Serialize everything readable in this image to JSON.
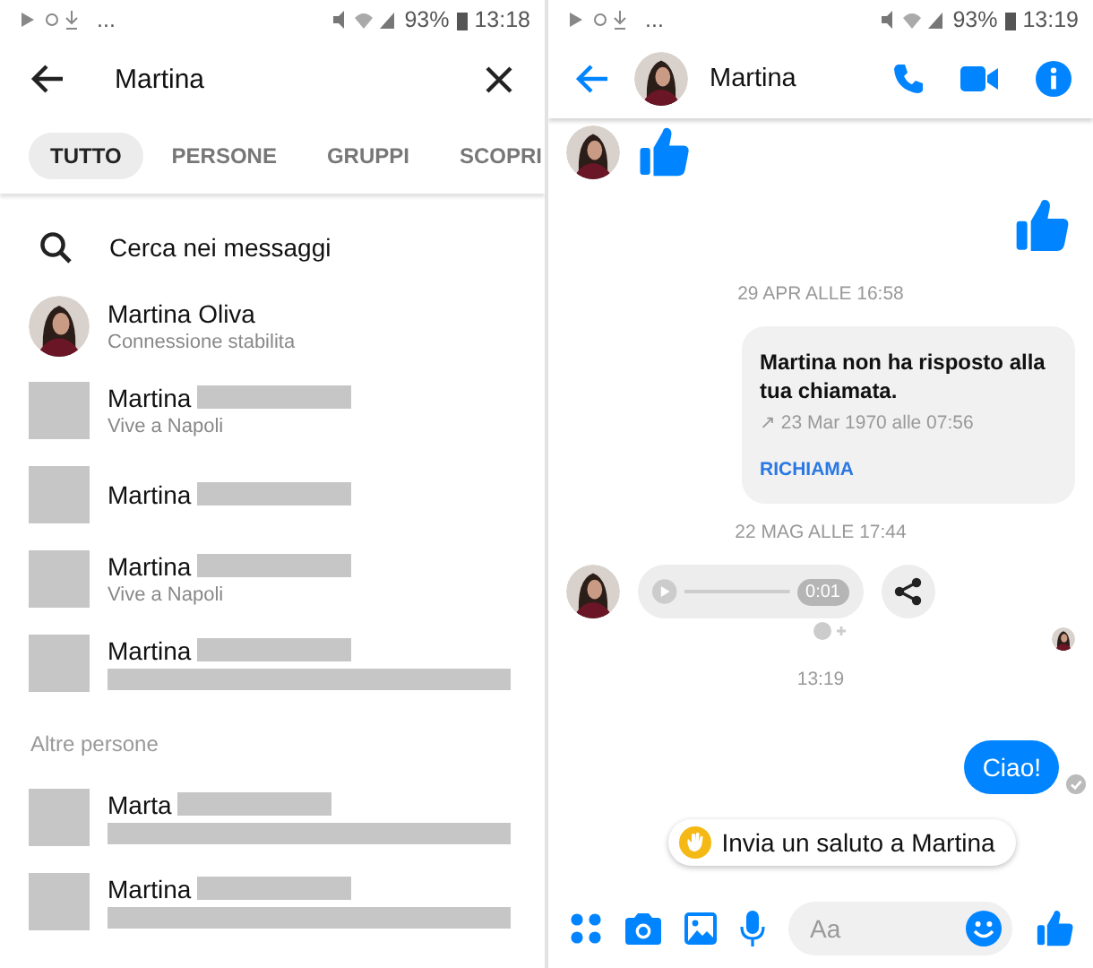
{
  "search_screen": {
    "status_bar": {
      "more": "...",
      "battery": "93%",
      "time": "13:18"
    },
    "search": {
      "value": "Martina"
    },
    "tabs": [
      {
        "label": "TUTTO",
        "selected": true
      },
      {
        "label": "PERSONE",
        "selected": false
      },
      {
        "label": "GRUPPI",
        "selected": false
      },
      {
        "label": "SCOPRI",
        "selected": false
      }
    ],
    "search_messages": "Cerca nei messaggi",
    "results": [
      {
        "kind": "photo",
        "name": "Martina Oliva",
        "subtitle": "Connessione stabilita"
      },
      {
        "kind": "placeholder",
        "name": "Martina",
        "name_redacted": true,
        "subtitle": "Vive a Napoli"
      },
      {
        "kind": "placeholder",
        "name": "Martina",
        "name_redacted": true
      },
      {
        "kind": "placeholder",
        "name": "Martina",
        "name_redacted": true,
        "subtitle": "Vive a Napoli"
      },
      {
        "kind": "placeholder",
        "name": "Martina",
        "name_redacted": true,
        "subtitle_redacted": true
      }
    ],
    "other_people": {
      "title": "Altre persone",
      "results": [
        {
          "kind": "placeholder",
          "name": "Marta",
          "name_redacted": true,
          "subtitle_redacted": true
        },
        {
          "kind": "placeholder",
          "name": "Martina",
          "name_redacted": true,
          "subtitle_redacted": true
        }
      ]
    }
  },
  "chat_screen": {
    "status_bar": {
      "more": "...",
      "battery": "93%",
      "time": "13:19"
    },
    "header": {
      "name": "Martina"
    },
    "messages": [
      {
        "kind": "like",
        "incoming": true
      },
      {
        "kind": "like",
        "incoming": false
      },
      {
        "kind": "timestamp",
        "text": "29 APR ALLE 16:58"
      },
      {
        "kind": "call",
        "text": "Martina non ha risposto alla tua chiamata.",
        "detail": "↗ 23 Mar 1970 alle 07:56",
        "action": "RICHIAMA"
      },
      {
        "kind": "timestamp",
        "text": "22 MAG ALLE 17:44"
      },
      {
        "kind": "audio",
        "duration": "0:01"
      },
      {
        "kind": "seen"
      },
      {
        "kind": "timestamp",
        "text": "13:19"
      },
      {
        "kind": "text",
        "incoming": false,
        "text": "Ciao!",
        "delivered": true
      }
    ],
    "wave_chip": "Invia un saluto a Martina",
    "composer": {
      "placeholder": "Aa"
    }
  }
}
